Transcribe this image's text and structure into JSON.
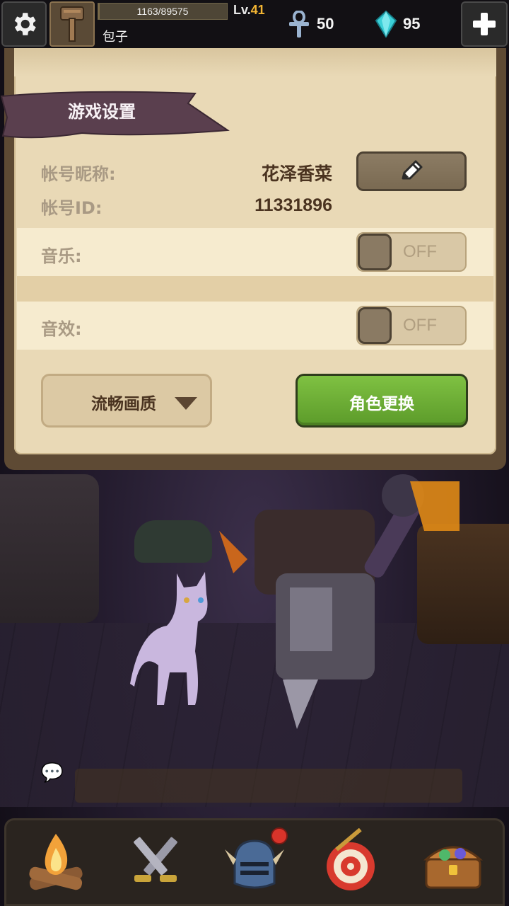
{
  "top_bar": {
    "xp_text": "1163/89575",
    "xp_fraction": 0.013,
    "level_prefix": "Lv.",
    "level_value": "41",
    "player_name": "包子",
    "ankh_count": "50",
    "gem_count": "95"
  },
  "settings": {
    "title": "游戏设置",
    "nickname_label": "帐号昵称:",
    "nickname_value": "花泽香菜",
    "account_id_label": "帐号ID:",
    "account_id_value": "11331896",
    "music_label": "音乐:",
    "music_state": "OFF",
    "sfx_label": "音效:",
    "sfx_state": "OFF",
    "quality_label": "流畅画质",
    "switch_role_label": "角色更换"
  },
  "colors": {
    "accent_green": "#6aab34",
    "panel_bg": "#e9d9b6",
    "ribbon": "#5a3f4e",
    "level_number": "#f3b533",
    "gem": "#3bd0d8"
  },
  "icons": [
    "gear-icon",
    "hammer-avatar-icon",
    "ankh-icon",
    "gem-icon",
    "plus-icon",
    "pencil-icon",
    "campfire-icon",
    "crossed-swords-icon",
    "knight-helmet-icon",
    "target-icon",
    "treasure-chest-icon",
    "chat-icon"
  ]
}
